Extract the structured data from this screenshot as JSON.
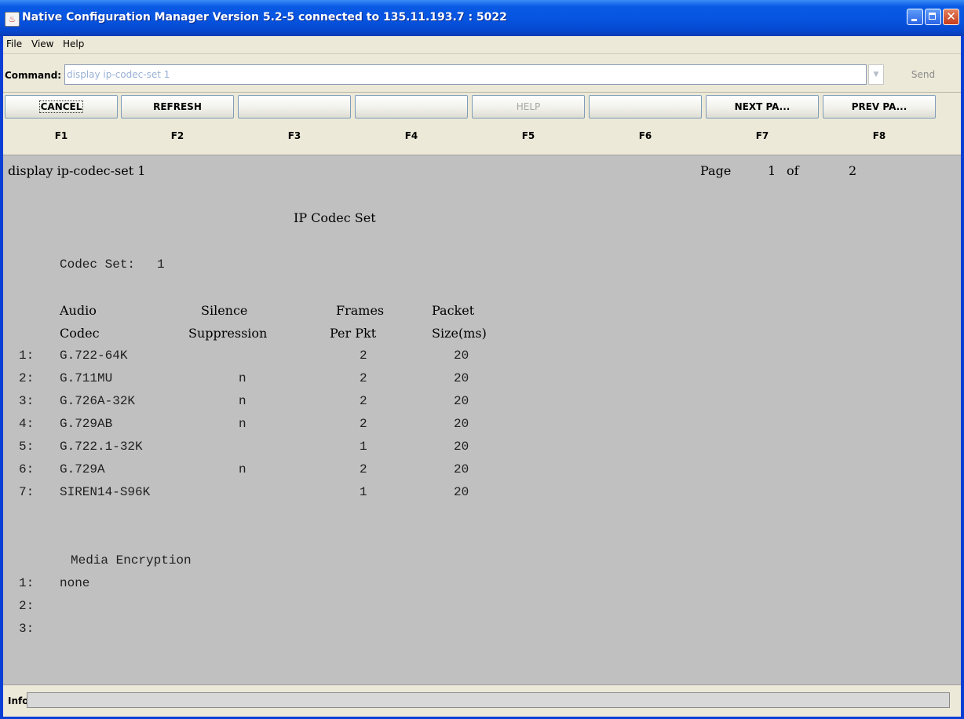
{
  "window": {
    "title": "Native Configuration Manager Version 5.2-5 connected to 135.11.193.7 : 5022"
  },
  "menu": [
    "File",
    "View",
    "Help"
  ],
  "command": {
    "label": "Command:",
    "value": "display ip-codec-set 1",
    "send_label": "Send"
  },
  "function_keys": [
    {
      "label": "CANCEL",
      "key": "F1"
    },
    {
      "label": "REFRESH",
      "key": "F2"
    },
    {
      "label": "",
      "key": "F3"
    },
    {
      "label": "",
      "key": "F4"
    },
    {
      "label": "HELP",
      "key": "F5"
    },
    {
      "label": "",
      "key": "F6"
    },
    {
      "label": "NEXT  PA...",
      "key": "F7"
    },
    {
      "label": "PREV  PA...",
      "key": "F8"
    }
  ],
  "screen": {
    "command_echo": "display ip-codec-set 1",
    "page_label": "Page",
    "page_current": "1",
    "page_of": "of",
    "page_total": "2",
    "heading": "IP Codec Set",
    "codec_set_label": "Codec Set:",
    "codec_set_value": "1",
    "col_headers_line1": [
      "Audio",
      "Silence",
      "Frames",
      "Packet"
    ],
    "col_headers_line2": [
      "Codec",
      "Suppression",
      "Per Pkt",
      "Size(ms)"
    ],
    "codec_rows": [
      {
        "num": "1:",
        "codec": "G.722-64K",
        "silence": "",
        "frames": "2",
        "size": "20"
      },
      {
        "num": "2:",
        "codec": "G.711MU",
        "silence": "n",
        "frames": "2",
        "size": "20"
      },
      {
        "num": "3:",
        "codec": "G.726A-32K",
        "silence": "n",
        "frames": "2",
        "size": "20"
      },
      {
        "num": "4:",
        "codec": "G.729AB",
        "silence": "n",
        "frames": "2",
        "size": "20"
      },
      {
        "num": "5:",
        "codec": "G.722.1-32K",
        "silence": "",
        "frames": "1",
        "size": "20"
      },
      {
        "num": "6:",
        "codec": "G.729A",
        "silence": "n",
        "frames": "2",
        "size": "20"
      },
      {
        "num": "7:",
        "codec": "SIREN14-S96K",
        "silence": "",
        "frames": "1",
        "size": "20"
      }
    ],
    "media_encryption_label": "Media Encryption",
    "encryption_rows": [
      {
        "num": "1:",
        "value": "none"
      },
      {
        "num": "2:",
        "value": ""
      },
      {
        "num": "3:",
        "value": ""
      }
    ]
  },
  "info": {
    "label": "Info:",
    "value": ""
  }
}
